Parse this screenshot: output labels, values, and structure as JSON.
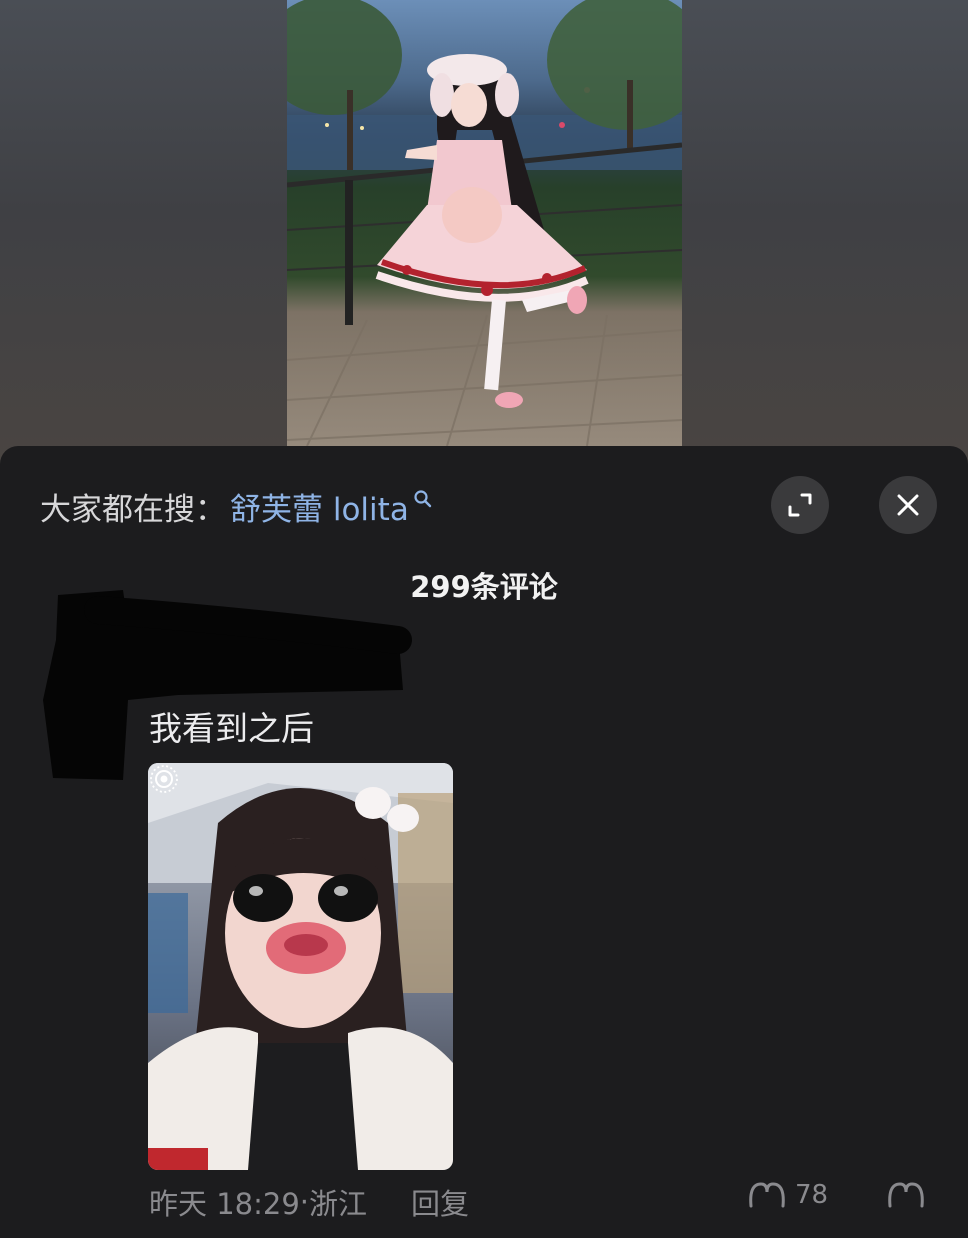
{
  "search": {
    "prefix": "大家都在搜：",
    "term": "舒芙蕾 lolita"
  },
  "buttons": {
    "expand_icon": "expand-icon",
    "close_icon": "close-icon"
  },
  "comments": {
    "count_label": "299条评论"
  },
  "comment": {
    "text": "我看到之后",
    "time": "昨天 18:29",
    "separator": "·",
    "location": "浙江",
    "reply_label": "回复",
    "like_count": "78"
  },
  "colors": {
    "sheet_bg": "#1c1c1e",
    "link_blue": "#8fb4e6",
    "muted_text": "#8a8a8e"
  }
}
